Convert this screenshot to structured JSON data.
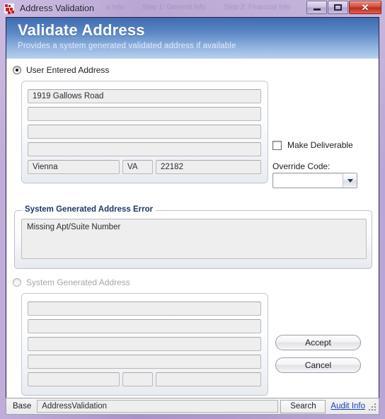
{
  "window": {
    "title": "Address Validation",
    "icon": "app-dots-icon",
    "controls": {
      "minimize": "minimize-icon",
      "restore": "restore-icon",
      "close": "close-icon",
      "close_glyph": "✕"
    },
    "ghost_text": [
      "a Info",
      "Step 1: General Info",
      "Step 2: Financial Info"
    ]
  },
  "banner": {
    "title": "Validate Address",
    "subtitle": "Provides a system generated validated address if available",
    "gradient_top": "#3f6cb1",
    "gradient_bottom": "#b6cfee"
  },
  "user_entered": {
    "radio_label": "User Entered Address",
    "radio_selected": true,
    "fields": {
      "line1": "1919 Gallows Road",
      "line2": "",
      "line3": "",
      "line4": "",
      "city": "Vienna",
      "state": "VA",
      "zip": "22182"
    }
  },
  "options": {
    "make_deliverable_label": "Make Deliverable",
    "make_deliverable_checked": false,
    "override_code_label": "Override Code:",
    "override_code_value": "",
    "dropdown_icon": "chevron-down-icon"
  },
  "error_group": {
    "legend": "System Generated Address Error",
    "legend_color": "#1f3864",
    "message": "Missing Apt/Suite Number"
  },
  "system_generated": {
    "radio_label": "System Generated Address",
    "radio_selected": false,
    "disabled": true,
    "fields": {
      "line1": "",
      "line2": "",
      "line3": "",
      "line4": "",
      "city": "",
      "state": "",
      "zip": ""
    }
  },
  "actions": {
    "accept_label": "Accept",
    "cancel_label": "Cancel"
  },
  "statusbar": {
    "base_label": "Base",
    "base_value": "AddressValidation",
    "search_label": "Search",
    "audit_link": "Audit Info",
    "grip": "resize-grip-icon"
  }
}
